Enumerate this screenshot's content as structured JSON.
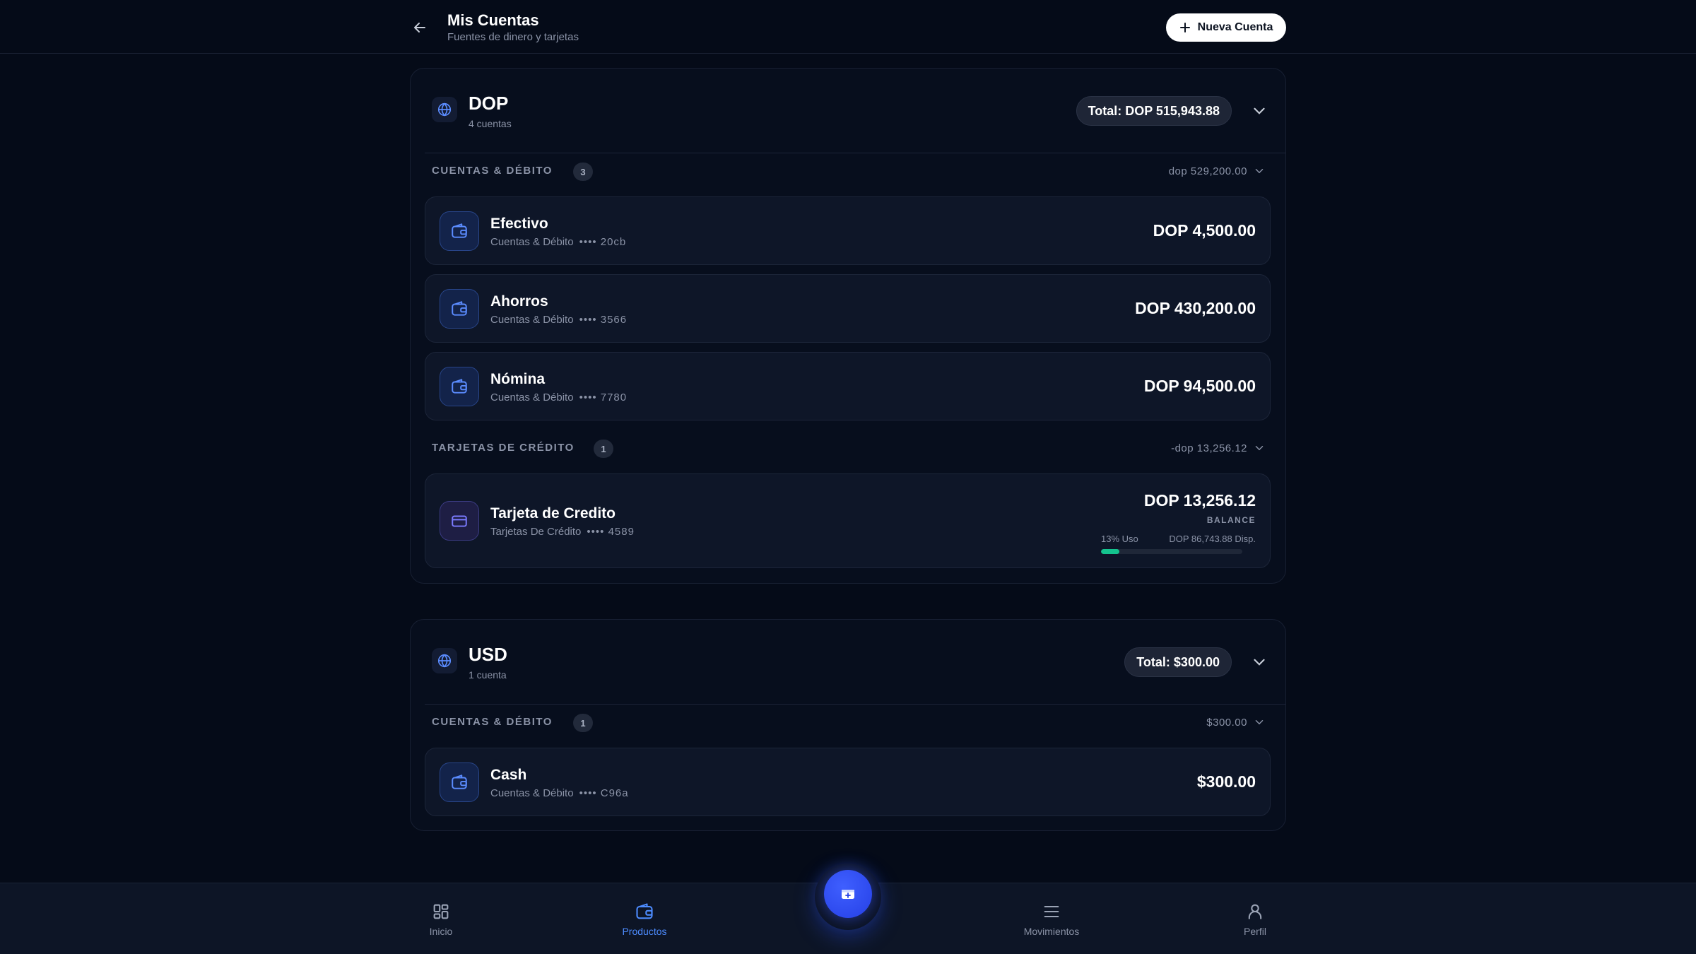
{
  "header": {
    "title": "Mis Cuentas",
    "subtitle": "Fuentes de dinero y tarjetas",
    "new_account_label": "Nueva Cuenta"
  },
  "groups": [
    {
      "code": "DOP",
      "count": "4 cuentas",
      "total": "Total: DOP 515,943.88",
      "sections": [
        {
          "label": "CUENTAS & DÉBITO",
          "badge": "3",
          "total": "dop 529,200.00",
          "accounts": [
            {
              "name": "Efectivo",
              "type": "Cuentas & Débito",
              "mask": "•••• 20cb",
              "amount": "DOP 4,500.00"
            },
            {
              "name": "Ahorros",
              "type": "Cuentas & Débito",
              "mask": "•••• 3566",
              "amount": "DOP 430,200.00"
            },
            {
              "name": "Nómina",
              "type": "Cuentas & Débito",
              "mask": "•••• 7780",
              "amount": "DOP 94,500.00"
            }
          ]
        },
        {
          "label": "TARJETAS DE CRÉDITO",
          "badge": "1",
          "total": "-dop 13,256.12",
          "accounts": [
            {
              "name": "Tarjeta de Credito",
              "type": "Tarjetas De Crédito",
              "mask": "•••• 4589",
              "amount": "DOP 13,256.12",
              "balance_label": "BALANCE",
              "usage_label": "13% Uso",
              "available": "DOP 86,743.88 Disp.",
              "usage_fraction": 0.13
            }
          ]
        }
      ]
    },
    {
      "code": "USD",
      "count": "1 cuenta",
      "total": "Total: $300.00",
      "sections": [
        {
          "label": "CUENTAS & DÉBITO",
          "badge": "1",
          "total": "$300.00",
          "accounts": [
            {
              "name": "Cash",
              "type": "Cuentas & Débito",
              "mask": "•••• C96a",
              "amount": "$300.00"
            }
          ]
        }
      ]
    }
  ],
  "nav": {
    "items": [
      {
        "label": "Inicio",
        "icon": "grid-icon"
      },
      {
        "label": "Productos",
        "icon": "wallet-icon",
        "active": true
      },
      {
        "label": "Movimientos",
        "icon": "list-icon"
      },
      {
        "label": "Perfil",
        "icon": "user-icon"
      }
    ],
    "fab_icon": "wallet-plus-icon"
  },
  "colors": {
    "background": "#050b18",
    "card": "#0e1628",
    "accent": "#4d8cff",
    "usage": "#14c38e",
    "fab": "#2d4cff"
  }
}
